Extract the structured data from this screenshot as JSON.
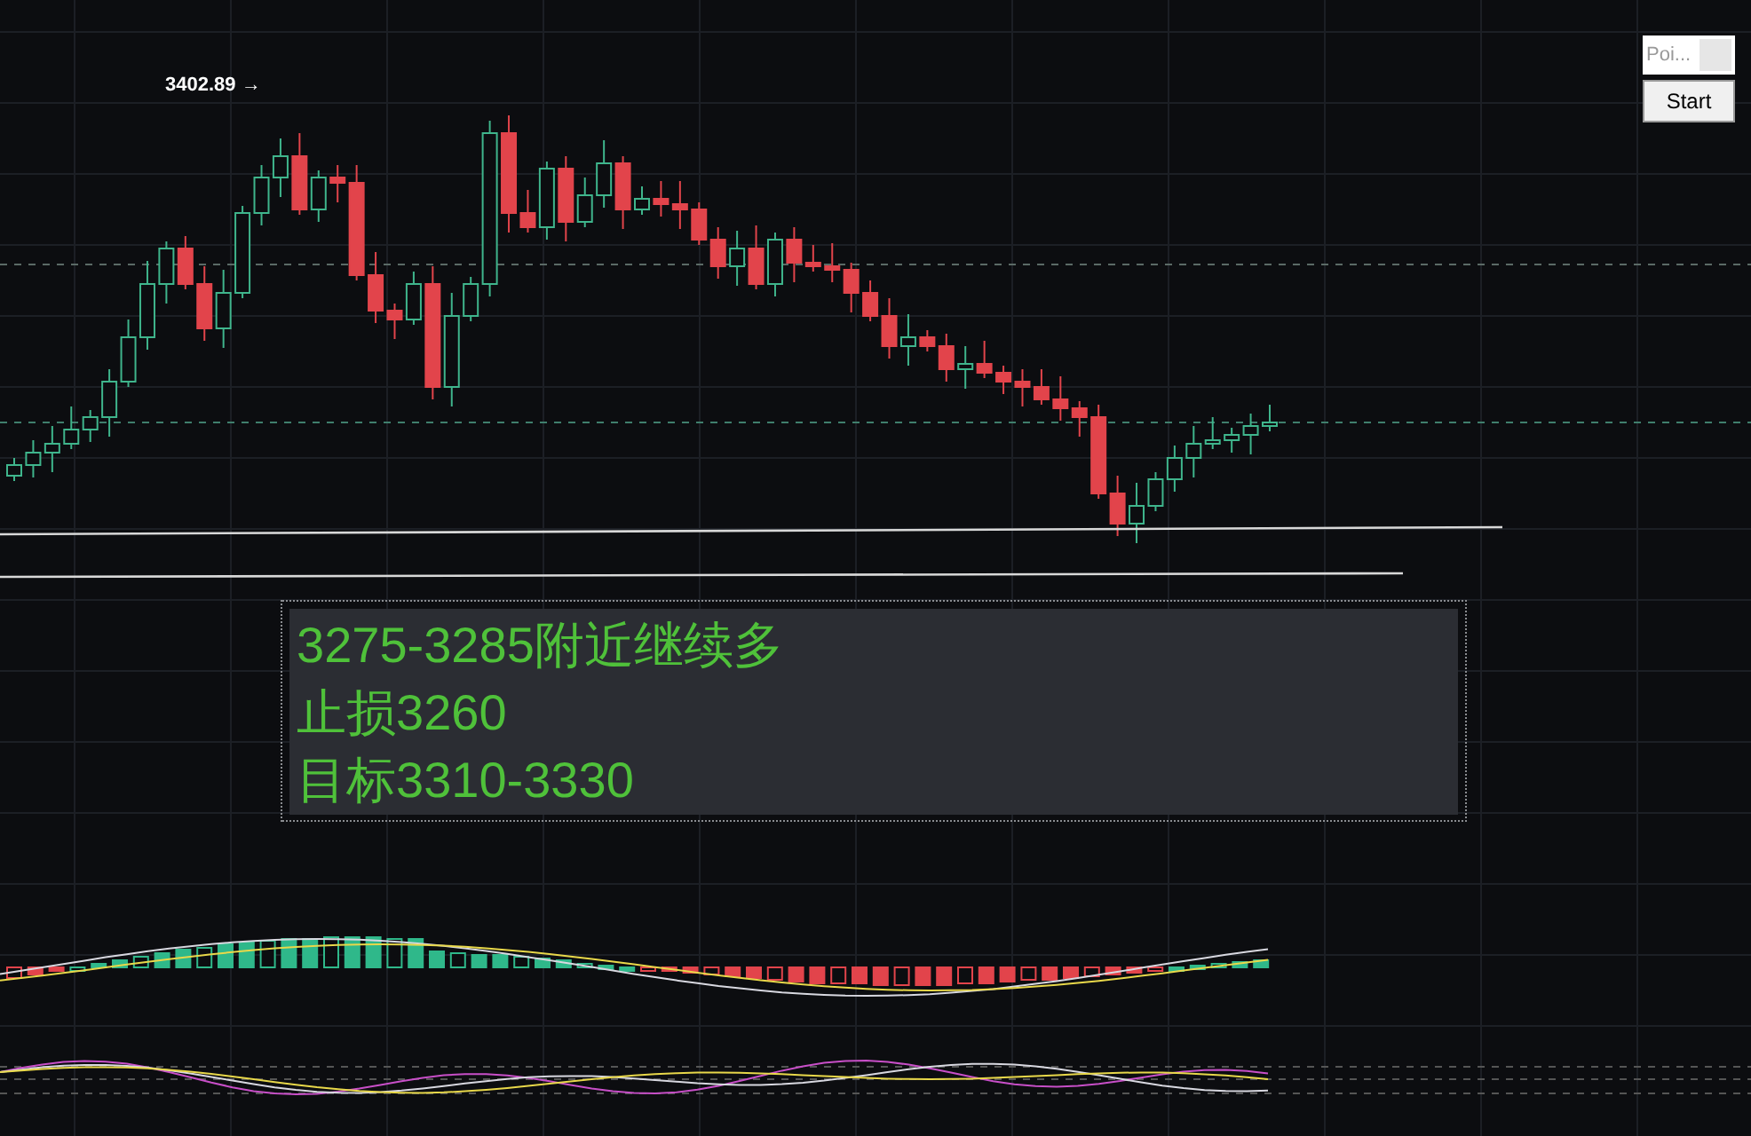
{
  "chart": {
    "high_label": "3402.89 →"
  },
  "widget": {
    "field": {
      "value": "Poi..."
    },
    "button": "Start"
  },
  "note": {
    "lines": [
      "3275-3285附近继续多",
      "止损3260",
      "目标3310-3330"
    ]
  }
}
